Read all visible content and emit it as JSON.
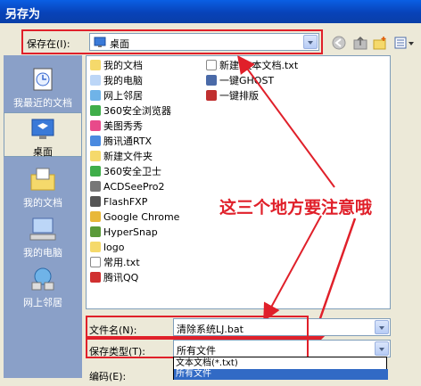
{
  "window": {
    "title": "另存为"
  },
  "save_in": {
    "label": "保存在(I):",
    "value": "桌面"
  },
  "places": [
    {
      "label": "我最近的文档",
      "icon": "recent-documents-icon"
    },
    {
      "label": "桌面",
      "icon": "desktop-icon"
    },
    {
      "label": "我的文档",
      "icon": "my-documents-icon"
    },
    {
      "label": "我的电脑",
      "icon": "my-computer-icon"
    },
    {
      "label": "网上邻居",
      "icon": "network-places-icon"
    }
  ],
  "files_col1": [
    {
      "name": "我的文档",
      "icon": "folder-icon"
    },
    {
      "name": "我的电脑",
      "icon": "computer-icon"
    },
    {
      "name": "网上邻居",
      "icon": "network-icon"
    },
    {
      "name": "360安全浏览器",
      "icon": "shortcut-icon"
    },
    {
      "name": "美图秀秀",
      "icon": "shortcut-icon"
    },
    {
      "name": "腾讯通RTX",
      "icon": "shortcut-icon"
    },
    {
      "name": "新建文件夹",
      "icon": "folder-icon"
    },
    {
      "name": "360安全卫士",
      "icon": "shortcut-icon"
    },
    {
      "name": "ACDSeePro2",
      "icon": "shortcut-icon"
    },
    {
      "name": "FlashFXP",
      "icon": "shortcut-icon"
    },
    {
      "name": "Google Chrome",
      "icon": "shortcut-icon"
    },
    {
      "name": "HyperSnap",
      "icon": "shortcut-icon"
    },
    {
      "name": "logo",
      "icon": "folder-icon"
    },
    {
      "name": "常用.txt",
      "icon": "text-file-icon"
    },
    {
      "name": "腾讯QQ",
      "icon": "shortcut-icon"
    }
  ],
  "files_col2": [
    {
      "name": "新建 文本文档.txt",
      "icon": "text-file-icon"
    },
    {
      "name": "一键GHOST",
      "icon": "shortcut-icon"
    },
    {
      "name": "一键排版",
      "icon": "shortcut-icon"
    }
  ],
  "filename": {
    "label": "文件名(N):",
    "value": "清除系统LJ.bat"
  },
  "filetype": {
    "label": "保存类型(T):",
    "value": "所有文件"
  },
  "encoding": {
    "label": "编码(E):"
  },
  "type_options": [
    "文本文档(*.txt)",
    "所有文件"
  ],
  "annotation": "这三个地方要注意哦",
  "colors": {
    "titlebar": "#0a50d0",
    "annotation": "#e0202a",
    "places_bg": "#8aa0c8",
    "dialog_bg": "#ece9d8"
  }
}
